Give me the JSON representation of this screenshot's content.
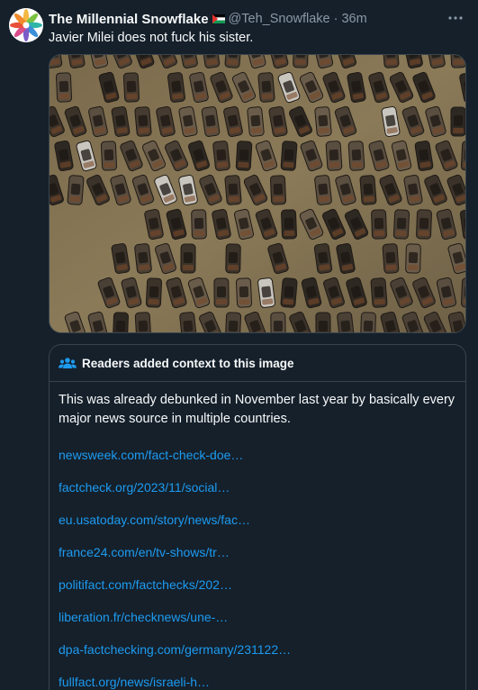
{
  "post": {
    "display_name": "The Millennial Snowflake",
    "flag_icon": "palestine-flag-icon",
    "handle": "@Teh_Snowflake",
    "separator": "·",
    "time": "36m",
    "text": "Javier Milei does not fuck his sister.",
    "more_icon": "more-horizontal-icon",
    "image_description_icon": "aerial-photo"
  },
  "community_note": {
    "icon": "people-icon",
    "title": "Readers added context to this image",
    "body": "This was already debunked in November last year by basically every major news source in multiple countries.",
    "links": [
      "newsweek.com/fact-check-doe…",
      "factcheck.org/2023/11/social…",
      "eu.usatoday.com/story/news/fac…",
      "france24.com/en/tv-shows/tr…",
      "politifact.com/factchecks/202…",
      "liberation.fr/checknews/une-…",
      "dpa-factchecking.com/germany/231122…",
      "fullfact.org/news/israeli-h…"
    ]
  },
  "colors": {
    "background": "#15202b",
    "text": "#f7f9f9",
    "secondary_text": "#8b98a5",
    "link": "#1d9bf0",
    "border": "#38444d",
    "note_icon": "#1d9bf0"
  }
}
